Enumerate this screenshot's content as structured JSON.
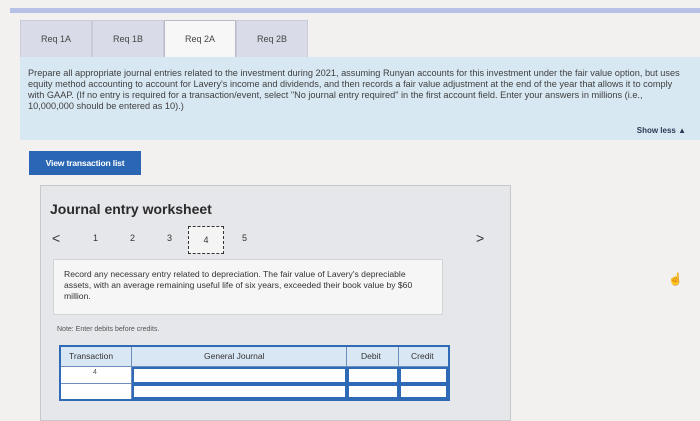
{
  "tabs": [
    {
      "label": "Req 1A"
    },
    {
      "label": "Req 1B"
    },
    {
      "label": "Req 2A"
    },
    {
      "label": "Req 2B"
    }
  ],
  "instructions": "Prepare all appropriate journal entries related to the investment during 2021, assuming Runyan accounts for this investment under the fair value option, but uses equity method accounting to account for Lavery's income and dividends, and then records a fair value adjustment at the end of the year that allows it to comply with GAAP. (If no entry is required for a transaction/event, select \"No journal entry required\" in the first account field. Enter your answers in millions (i.e., 10,000,000 should be entered as 10).)",
  "show_less": "Show less ▲",
  "view_transaction_list": "View transaction list",
  "worksheet": {
    "title": "Journal entry worksheet",
    "nav_prev": "<",
    "nav_next": ">",
    "pages": [
      "1",
      "2",
      "3",
      "4",
      "5"
    ],
    "active_page": "4",
    "task_text": "Record any necessary entry related to depreciation. The fair value of Lavery's depreciable assets, with an average remaining useful life of six years, exceeded their book value by $60 million.",
    "note": "Note: Enter debits before credits.",
    "table": {
      "headers": [
        "Transaction",
        "General Journal",
        "Debit",
        "Credit"
      ],
      "rows": [
        {
          "transaction": "4"
        }
      ]
    }
  },
  "colors": {
    "accent": "#2a66b3",
    "panel": "#d8e8f3"
  },
  "icons": {
    "cursor": "hand-pointer-icon"
  }
}
